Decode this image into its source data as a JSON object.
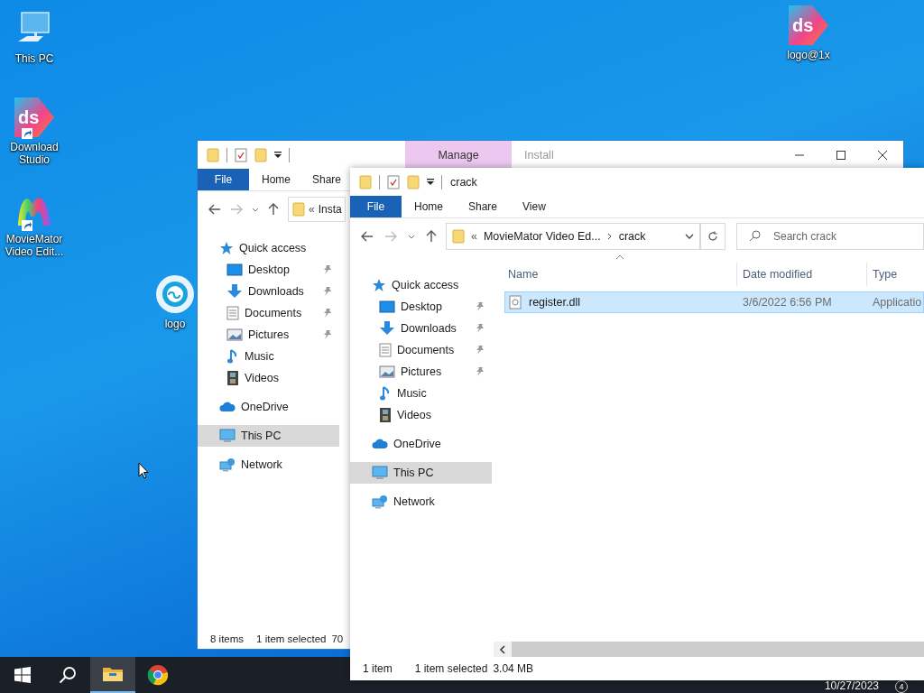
{
  "desktop": {
    "icons": [
      {
        "label": "This PC",
        "kind": "pc",
        "shortcut": false
      },
      {
        "label": "Download Studio",
        "kind": "ds",
        "shortcut": true,
        "logo_text": "ds"
      },
      {
        "label": "MovieMator Video Edit...",
        "kind": "moviemator",
        "shortcut": true
      },
      {
        "label": "logo",
        "kind": "ring",
        "shortcut": false
      },
      {
        "label": "logo@1x",
        "kind": "ds",
        "shortcut": false,
        "logo_text": "ds"
      }
    ]
  },
  "windows": [
    {
      "contextual_tab": "Manage",
      "title": "Install",
      "window_buttons": true,
      "ribbon": [
        {
          "label": "File",
          "kind": "file"
        },
        {
          "label": "Home",
          "kind": "tab"
        },
        {
          "label": "Share",
          "kind": "tab"
        }
      ],
      "address": {
        "overflow_mark": "«",
        "segments": [
          "Insta"
        ]
      },
      "nav": [
        {
          "label": "Quick access",
          "kind": "star",
          "selected": false,
          "children": [
            {
              "label": "Desktop",
              "kind": "desktop",
              "pinned": true,
              "selected": false
            },
            {
              "label": "Downloads",
              "kind": "downloads",
              "pinned": true,
              "selected": false
            },
            {
              "label": "Documents",
              "kind": "documents",
              "pinned": true,
              "selected": false
            },
            {
              "label": "Pictures",
              "kind": "pictures",
              "pinned": true,
              "selected": false
            },
            {
              "label": "Music",
              "kind": "music",
              "pinned": false,
              "selected": false
            },
            {
              "label": "Videos",
              "kind": "videos",
              "pinned": false,
              "selected": false
            }
          ]
        },
        {
          "label": "OneDrive",
          "kind": "cloud",
          "selected": false
        },
        {
          "label": "This PC",
          "kind": "pc",
          "selected": true
        },
        {
          "label": "Network",
          "kind": "network",
          "selected": false
        }
      ],
      "status": [
        "8 items",
        "1 item selected",
        "70"
      ]
    },
    {
      "title": "crack",
      "ribbon": [
        {
          "label": "File",
          "kind": "file"
        },
        {
          "label": "Home",
          "kind": "tab"
        },
        {
          "label": "Share",
          "kind": "tab"
        },
        {
          "label": "View",
          "kind": "tab"
        }
      ],
      "address": {
        "overflow_mark": "«",
        "segments": [
          "MovieMator Video Ed...",
          "crack"
        ],
        "refresh": true
      },
      "search": {
        "placeholder": "Search crack"
      },
      "nav": [
        {
          "label": "Quick access",
          "kind": "star",
          "selected": false,
          "children": [
            {
              "label": "Desktop",
              "kind": "desktop",
              "pinned": true,
              "selected": false
            },
            {
              "label": "Downloads",
              "kind": "downloads",
              "pinned": true,
              "selected": false
            },
            {
              "label": "Documents",
              "kind": "documents",
              "pinned": true,
              "selected": false
            },
            {
              "label": "Pictures",
              "kind": "pictures",
              "pinned": true,
              "selected": false
            },
            {
              "label": "Music",
              "kind": "music",
              "pinned": false,
              "selected": false
            },
            {
              "label": "Videos",
              "kind": "videos",
              "pinned": false,
              "selected": false
            }
          ]
        },
        {
          "label": "OneDrive",
          "kind": "cloud",
          "selected": false
        },
        {
          "label": "This PC",
          "kind": "pc",
          "selected": true
        },
        {
          "label": "Network",
          "kind": "network",
          "selected": false
        }
      ],
      "columns": [
        {
          "label": "Name",
          "sorted": true
        },
        {
          "label": "Date modified",
          "sorted": false
        },
        {
          "label": "Type",
          "sorted": false
        }
      ],
      "rows": [
        {
          "name": "register.dll",
          "date": "3/6/2022 6:56 PM",
          "type": "Applicatio",
          "selected": true
        }
      ],
      "status": [
        "1 item",
        "1 item selected",
        "3.04 MB"
      ]
    }
  ],
  "taskbar": {
    "buttons": [
      {
        "kind": "start",
        "active": false
      },
      {
        "kind": "search",
        "active": false
      },
      {
        "kind": "explorer",
        "active": true
      },
      {
        "kind": "chrome",
        "active": false
      }
    ],
    "date": "10/27/2023",
    "notifications": "4"
  }
}
